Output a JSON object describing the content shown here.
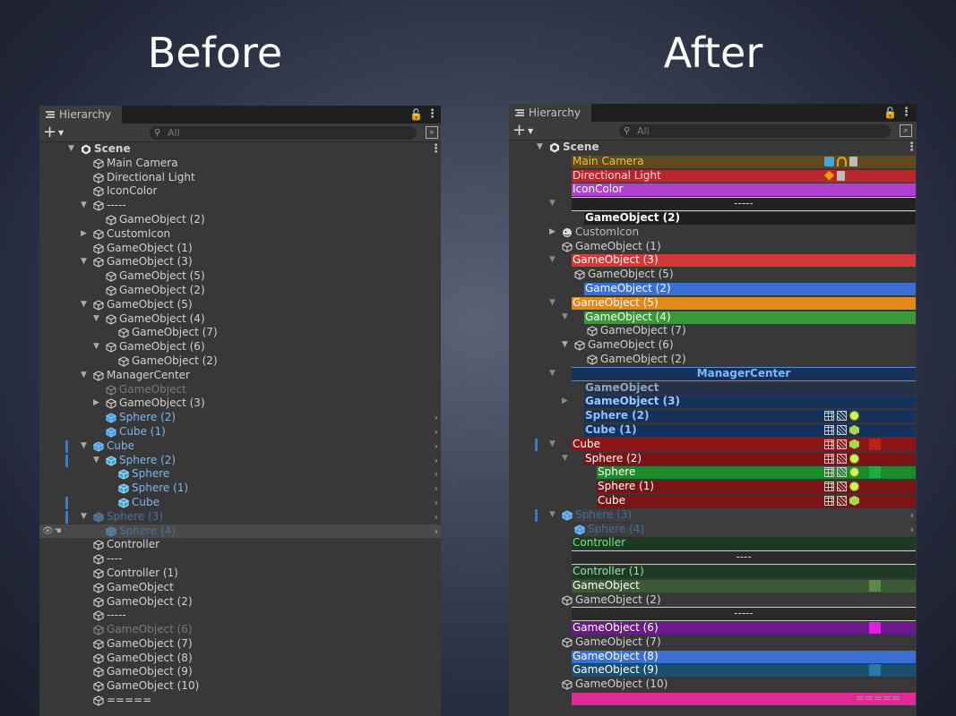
{
  "headings": {
    "before": "Before",
    "after": "After"
  },
  "panel": {
    "tab_label": "Hierarchy",
    "search_placeholder": "All",
    "lock_glyph": "🔓",
    "menu_glyph": "⋮"
  },
  "colors": {
    "panel_bg": "#383838",
    "selected": "#3a78c8"
  },
  "before_rows": [
    {
      "d": 0,
      "a": "down",
      "icon": "unity",
      "label": "Scene",
      "bold": true,
      "menu": true
    },
    {
      "d": 1,
      "icon": "cube",
      "label": "Main Camera"
    },
    {
      "d": 1,
      "icon": "cube",
      "label": "Directional Light"
    },
    {
      "d": 1,
      "icon": "cube",
      "label": "IconColor"
    },
    {
      "d": 1,
      "a": "down",
      "icon": "cube",
      "label": "-----"
    },
    {
      "d": 2,
      "icon": "cube",
      "label": "GameObject (2)"
    },
    {
      "d": 1,
      "a": "right",
      "icon": "cube",
      "label": "CustomIcon"
    },
    {
      "d": 1,
      "icon": "cube",
      "label": "GameObject (1)"
    },
    {
      "d": 1,
      "a": "down",
      "icon": "cube",
      "label": "GameObject (3)"
    },
    {
      "d": 2,
      "icon": "cube",
      "label": "GameObject (5)"
    },
    {
      "d": 2,
      "icon": "cube",
      "label": "GameObject (2)"
    },
    {
      "d": 1,
      "a": "down",
      "icon": "cube",
      "label": "GameObject (5)"
    },
    {
      "d": 2,
      "a": "down",
      "icon": "cube",
      "label": "GameObject (4)"
    },
    {
      "d": 3,
      "icon": "cube",
      "label": "GameObject (7)"
    },
    {
      "d": 2,
      "a": "down",
      "icon": "cube",
      "label": "GameObject (6)"
    },
    {
      "d": 3,
      "icon": "cube",
      "label": "GameObject (2)"
    },
    {
      "d": 1,
      "a": "down",
      "icon": "cube",
      "label": "ManagerCenter"
    },
    {
      "d": 2,
      "icon": "cube",
      "label": "GameObject",
      "dim": true
    },
    {
      "d": 2,
      "a": "right",
      "icon": "cube",
      "label": "GameObject (3)"
    },
    {
      "d": 2,
      "icon": "pcube",
      "label": "Sphere (2)",
      "prefab": true,
      "chev": true
    },
    {
      "d": 2,
      "icon": "pcube",
      "label": "Cube (1)",
      "prefab": true,
      "chev": true
    },
    {
      "d": 1,
      "a": "down",
      "icon": "pcube",
      "label": "Cube",
      "prefab": true,
      "chev": true,
      "bar": true
    },
    {
      "d": 2,
      "a": "down",
      "icon": "pcubeg",
      "label": "Sphere (2)",
      "prefab": true,
      "chev": true,
      "bar": true
    },
    {
      "d": 3,
      "icon": "pcubeg",
      "label": "Sphere",
      "prefab": true,
      "chev": true
    },
    {
      "d": 3,
      "icon": "pcubeg",
      "label": "Sphere (1)",
      "prefab": true,
      "chev": true
    },
    {
      "d": 3,
      "icon": "pcubeg",
      "label": "Cube",
      "prefab": true,
      "chev": true,
      "bar": true
    },
    {
      "d": 1,
      "a": "down",
      "icon": "pcube",
      "label": "Sphere (3)",
      "prefab": true,
      "dim": true,
      "chev": true,
      "bar": true
    },
    {
      "d": 2,
      "icon": "pcube",
      "label": "Sphere (4)",
      "prefab": true,
      "dim": true,
      "chev": true,
      "hover": true
    },
    {
      "d": 1,
      "icon": "cube",
      "label": "Controller"
    },
    {
      "d": 1,
      "icon": "cube",
      "label": "----"
    },
    {
      "d": 1,
      "icon": "cube",
      "label": "Controller (1)"
    },
    {
      "d": 1,
      "icon": "cube",
      "label": "GameObject"
    },
    {
      "d": 1,
      "icon": "cube",
      "label": "GameObject (2)"
    },
    {
      "d": 1,
      "icon": "cube",
      "label": "-----"
    },
    {
      "d": 1,
      "icon": "cube",
      "label": "GameObject (6)",
      "dim": true
    },
    {
      "d": 1,
      "icon": "cube",
      "label": "GameObject (7)"
    },
    {
      "d": 1,
      "icon": "cube",
      "label": "GameObject (8)"
    },
    {
      "d": 1,
      "icon": "cube",
      "label": "GameObject (9)"
    },
    {
      "d": 1,
      "icon": "cube",
      "label": "GameObject (10)"
    },
    {
      "d": 1,
      "icon": "cube",
      "label": "====="
    }
  ],
  "after_rows": [
    {
      "d": 0,
      "a": "down",
      "icon": "unity",
      "label": "Scene",
      "bold": true,
      "menu": true
    },
    {
      "d": 1,
      "label": "Main Camera",
      "bg": "#5e4a1c",
      "fg": "#f0c040",
      "right": [
        "cam",
        "head",
        "sq"
      ]
    },
    {
      "d": 1,
      "label": "Directional Light",
      "bg": "#b8262e",
      "fg": "#ffd8d8",
      "right": [
        "light",
        "sq"
      ]
    },
    {
      "d": 1,
      "label": "IconColor",
      "bg": "#b23fd0",
      "fg": "#ffffff"
    },
    {
      "d": 1,
      "a": "down",
      "label": "-----",
      "sep": true,
      "bg": "#222222"
    },
    {
      "d": 2,
      "label": "GameObject (2)",
      "bg": "#1f1f1f",
      "fg": "#ffffff",
      "bold": true
    },
    {
      "d": 1,
      "a": "right",
      "icon": "custom",
      "label": "CustomIcon",
      "fg": "#bbbbbb"
    },
    {
      "d": 1,
      "icon": "cube",
      "label": "GameObject (1)"
    },
    {
      "d": 1,
      "a": "down",
      "label": "GameObject (3)",
      "bg": "#d23a3a",
      "fg": "#ffffff"
    },
    {
      "d": 2,
      "icon": "cube",
      "label": "GameObject (5)"
    },
    {
      "d": 2,
      "label": "GameObject (2)",
      "bg": "#3a6fd6",
      "fg": "#ffffff"
    },
    {
      "d": 1,
      "a": "down",
      "label": "GameObject (5)",
      "bg": "#e08a1e",
      "fg": "#ffffff"
    },
    {
      "d": 2,
      "a": "down",
      "label": "GameObject (4)",
      "bg": "#3a9a3a",
      "fg": "#ffffff"
    },
    {
      "d": 3,
      "icon": "cube",
      "label": "GameObject (7)"
    },
    {
      "d": 2,
      "a": "down",
      "icon": "cube",
      "label": "GameObject (6)"
    },
    {
      "d": 3,
      "icon": "cube",
      "label": "GameObject (2)"
    },
    {
      "d": 1,
      "a": "down",
      "label": "ManagerCenter",
      "sep": true,
      "center": true,
      "bg": "#16325a",
      "fg": "#7fb8ff",
      "bold": true,
      "sepcolor": "#5a8fd8"
    },
    {
      "d": 2,
      "label": "GameObject",
      "bg": "#233246",
      "fg": "#8fa6c2",
      "bold": true
    },
    {
      "d": 2,
      "a": "right",
      "label": "GameObject (3)",
      "bg": "#16325a",
      "fg": "#9fc8ff",
      "bold": true
    },
    {
      "d": 2,
      "label": "Sphere (2)",
      "bg": "#16325a",
      "fg": "#8fc0ff",
      "bold": true,
      "right": [
        "grid",
        "grid2",
        "dot"
      ],
      "rightx": "narrow"
    },
    {
      "d": 2,
      "label": "Cube (1)",
      "bg": "#16325a",
      "fg": "#8fc0ff",
      "bold": true,
      "right": [
        "grid",
        "grid2",
        "cube"
      ],
      "rightx": "narrow"
    },
    {
      "d": 1,
      "a": "down",
      "label": "Cube",
      "bg": "#8a1616",
      "fg": "#ffffff",
      "bar": true,
      "right": [
        "grid",
        "grid2",
        "cube"
      ],
      "swatch": "#c0201a"
    },
    {
      "d": 2,
      "a": "down",
      "label": "Sphere (2)",
      "bg": "#7a1414",
      "fg": "#ffffff",
      "right": [
        "grid",
        "grid2",
        "dot"
      ]
    },
    {
      "d": 3,
      "label": "Sphere",
      "bg": "#1a8a2a",
      "fg": "#ffffff",
      "right": [
        "grid",
        "grid2",
        "dot"
      ],
      "swatch": "#1fae3a"
    },
    {
      "d": 3,
      "label": "Sphere (1)",
      "bg": "#7a1414",
      "fg": "#ffffff",
      "right": [
        "grid",
        "grid2",
        "dot"
      ]
    },
    {
      "d": 3,
      "label": "Cube",
      "bg": "#7a1414",
      "fg": "#ffffff",
      "right": [
        "grid",
        "grid2",
        "cube"
      ]
    },
    {
      "d": 1,
      "a": "down",
      "icon": "pcube",
      "label": "Sphere (3)",
      "fg": "#4a6a9a",
      "chev": true,
      "bar": true,
      "bg": "#3e3e3e"
    },
    {
      "d": 2,
      "icon": "pcube",
      "label": "Sphere (4)",
      "fg": "#4a6a9a",
      "chev": true,
      "bg": "#3e3e3e"
    },
    {
      "d": 1,
      "label": "Controller",
      "bg": "#1e3a24",
      "fg": "#7ee08a"
    },
    {
      "d": 1,
      "label": "----",
      "sep": true,
      "bg": "#2a2a2a"
    },
    {
      "d": 1,
      "label": "Controller (1)",
      "bg": "#1e3a24",
      "fg": "#9fe0a8"
    },
    {
      "d": 1,
      "label": "GameObject",
      "bg": "#3c5a34",
      "fg": "#ffffff",
      "swatch": "#5a8a4a"
    },
    {
      "d": 1,
      "icon": "cube",
      "label": "GameObject (2)"
    },
    {
      "d": 1,
      "label": "-----",
      "sep": true,
      "bg": "#2a2a2a"
    },
    {
      "d": 1,
      "label": "GameObject (6)",
      "bg": "#6a1a8a",
      "fg": "#ffffff",
      "swatch": "#e020e0"
    },
    {
      "d": 1,
      "icon": "cube",
      "label": "GameObject (7)"
    },
    {
      "d": 1,
      "label": "GameObject (8)",
      "bg": "#3a6fd6",
      "fg": "#ffffff"
    },
    {
      "d": 1,
      "label": "GameObject (9)",
      "bg": "#1c4e6e",
      "fg": "#ffffff",
      "swatch": "#2a7aa8"
    },
    {
      "d": 1,
      "icon": "cube",
      "label": "GameObject (10)"
    },
    {
      "d": 1,
      "label": "=====",
      "bg": "#e02a9a",
      "fg": "#3fdc6a",
      "rightlabel": true
    }
  ]
}
